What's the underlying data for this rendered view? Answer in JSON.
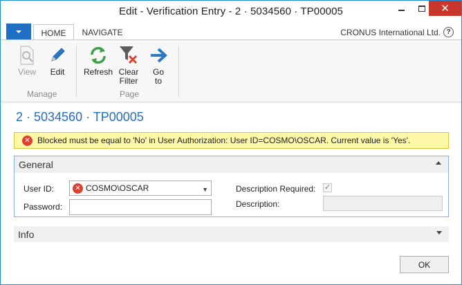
{
  "window": {
    "title": "Edit - Verification Entry - 2 · 5034560 · TP00005",
    "minimize_icon": "minimize-icon",
    "maximize_icon": "maximize-icon",
    "close_icon": "close-icon",
    "close_glyph": "✕",
    "border_color": "#1d8fd6"
  },
  "ribbon_tabs": {
    "app_menu_icon": "dropdown-icon",
    "home": "HOME",
    "navigate": "NAVIGATE",
    "company": "CRONUS International Ltd.",
    "help_glyph": "?"
  },
  "ribbon": {
    "view_label": "View",
    "edit_label": "Edit",
    "refresh_label": "Refresh",
    "clear_filter_label": "Clear\nFilter",
    "goto_label": "Go\nto",
    "manage_group": "Manage",
    "page_group": "Page",
    "icons": {
      "view": "view-magnifier-icon",
      "edit": "pencil-icon",
      "refresh": "refresh-arrows-icon",
      "clear_filter": "funnel-x-icon",
      "goto": "arrow-right-icon"
    }
  },
  "page": {
    "title": "2 · 5034560 · TP00005",
    "accent_color": "#1f6fc5"
  },
  "error": {
    "icon": "error-x-icon",
    "icon_glyph": "✕",
    "message": "Blocked must be equal to 'No'  in User Authorization: User ID=COSMO\\OSCAR. Current value is 'Yes'.",
    "background": "#fdf7a8"
  },
  "general": {
    "header": "General",
    "user_id_label": "User ID:",
    "user_id_value": "COSMO\\OSCAR",
    "user_id_error_glyph": "✕",
    "password_label": "Password:",
    "password_value": "",
    "description_required_label": "Description Required:",
    "description_required_checked": true,
    "check_glyph": "✓",
    "description_label": "Description:",
    "description_value": ""
  },
  "info": {
    "header": "Info"
  },
  "footer": {
    "ok_label": "OK"
  }
}
